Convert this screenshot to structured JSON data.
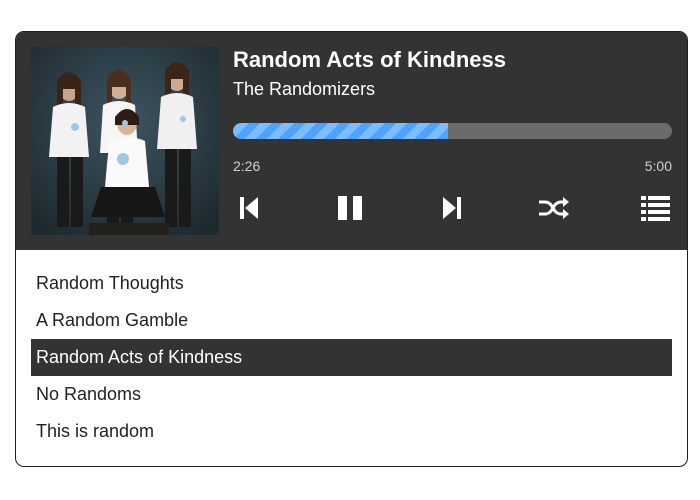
{
  "now_playing": {
    "title": "Random Acts of Kindness",
    "artist": "The Randomizers",
    "progress_fraction": 0.489,
    "elapsed": "2:26",
    "duration": "5:00"
  },
  "controls": [
    {
      "name": "previous-button",
      "icon": "skip-back-icon"
    },
    {
      "name": "pause-button",
      "icon": "pause-icon"
    },
    {
      "name": "next-button",
      "icon": "skip-forward-icon"
    },
    {
      "name": "shuffle-button",
      "icon": "shuffle-icon"
    },
    {
      "name": "playlist-button",
      "icon": "list-icon"
    }
  ],
  "playlist": [
    {
      "title": "Random Thoughts",
      "active": false
    },
    {
      "title": "A Random Gamble",
      "active": false
    },
    {
      "title": "Random Acts of Kindness",
      "active": true
    },
    {
      "title": "No Randoms",
      "active": false
    },
    {
      "title": "This is random",
      "active": false
    }
  ],
  "colors": {
    "panel_bg": "#333333",
    "progress_fill": "#4da3ff",
    "progress_track": "#6b6b6b",
    "active_row_bg": "#333333",
    "text_light": "#ffffff"
  }
}
